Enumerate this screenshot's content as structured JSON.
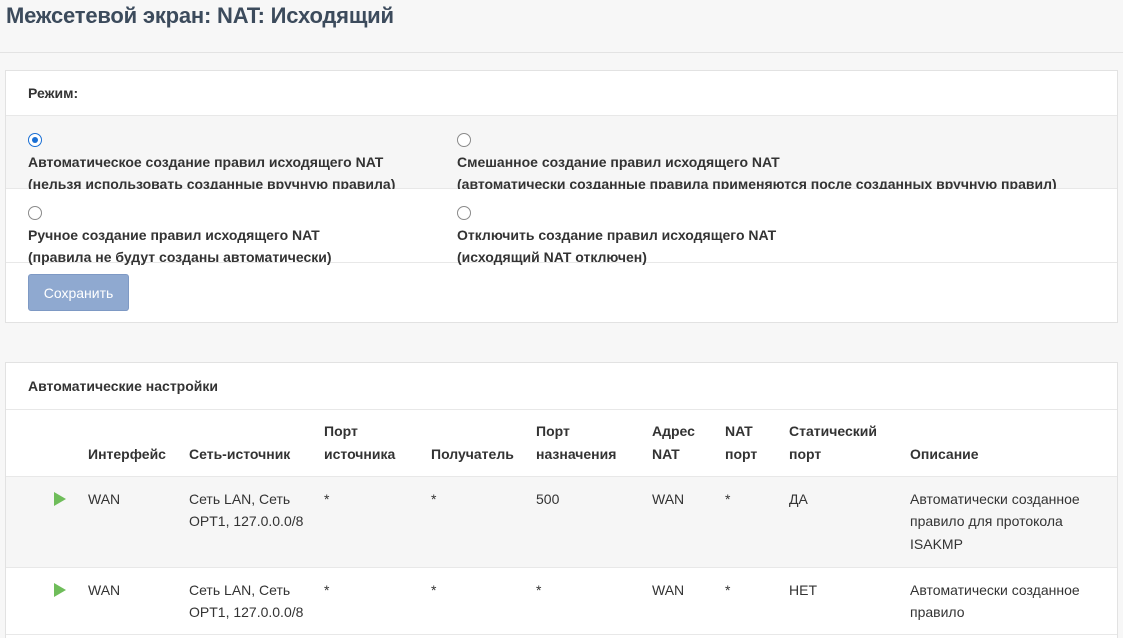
{
  "page": {
    "title": "Межсетевой экран: NAT: Исходящий"
  },
  "mode": {
    "heading": "Режим:",
    "options": [
      {
        "line1": "Автоматическое создание правил исходящего NAT",
        "line2": "(нельзя использовать созданные вручную правила)",
        "checked": true
      },
      {
        "line1": "Смешанное создание правил исходящего NAT",
        "line2": "(автоматически созданные правила применяются после созданных вручную правил)",
        "checked": false
      },
      {
        "line1": "Ручное создание правил исходящего NAT",
        "line2": "(правила не будут созданы автоматически)",
        "checked": false
      },
      {
        "line1": "Отключить создание правил исходящего NAT",
        "line2": "(исходящий NAT отключен)",
        "checked": false
      }
    ],
    "save_label": "Сохранить"
  },
  "auto": {
    "heading": "Автоматические настройки",
    "columns": {
      "interface": "Интерфейс",
      "source_net": "Сеть-источник",
      "source_port_1": "Порт",
      "source_port_2": "источника",
      "destination": "Получатель",
      "dest_port_1": "Порт",
      "dest_port_2": "назначения",
      "nat_addr_1": "Адрес",
      "nat_addr_2": "NAT",
      "nat_port_1": "NAT",
      "nat_port_2": "порт",
      "static_port_1": "Статический",
      "static_port_2": "порт",
      "description": "Описание"
    },
    "rows": [
      {
        "status_icon": "play-icon",
        "interface": "WAN",
        "source_net_1": "Сеть LAN, Сеть",
        "source_net_2": "OPT1, 127.0.0.0/8",
        "source_port": "*",
        "destination": "*",
        "dest_port": "500",
        "nat_address": "WAN",
        "nat_port": "*",
        "static_port": "ДА",
        "description_1": "Автоматически созданное",
        "description_2": "правило для протокола",
        "description_3": "ISAKMP"
      },
      {
        "status_icon": "play-icon",
        "interface": "WAN",
        "source_net_1": "Сеть LAN, Сеть",
        "source_net_2": "OPT1, 127.0.0.0/8",
        "source_port": "*",
        "destination": "*",
        "dest_port": "*",
        "nat_address": "WAN",
        "nat_port": "*",
        "static_port": "НЕТ",
        "description_1": "Автоматически созданное",
        "description_2": "правило",
        "description_3": ""
      }
    ]
  },
  "colors": {
    "title": "#3c4b5c",
    "radio_checked": "#1a6fd4",
    "save_button": "#8fa9d0",
    "play_icon": "#6fbd5a"
  }
}
